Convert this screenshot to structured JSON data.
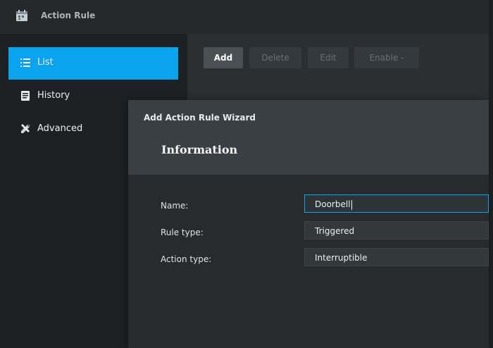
{
  "window": {
    "title": "Action Rule",
    "app_icon": "calendar-icon"
  },
  "sidebar": {
    "items": [
      {
        "label": "List",
        "icon": "list-icon",
        "active": true
      },
      {
        "label": "History",
        "icon": "document-icon",
        "active": false
      },
      {
        "label": "Advanced",
        "icon": "tools-icon",
        "active": false
      }
    ]
  },
  "toolbar": {
    "add_label": "Add",
    "delete_label": "Delete",
    "edit_label": "Edit",
    "enable_label": "Enable -"
  },
  "dialog": {
    "title": "Add Action Rule Wizard",
    "subtitle": "Information",
    "fields": [
      {
        "label": "Name:",
        "value": "Doorbell"
      },
      {
        "label": "Rule type:",
        "value": "Triggered"
      },
      {
        "label": "Action type:",
        "value": "Interruptible"
      }
    ]
  },
  "colors": {
    "accent": "#0aa3f0",
    "background": "#1d2023",
    "panel": "#2b2f32"
  }
}
